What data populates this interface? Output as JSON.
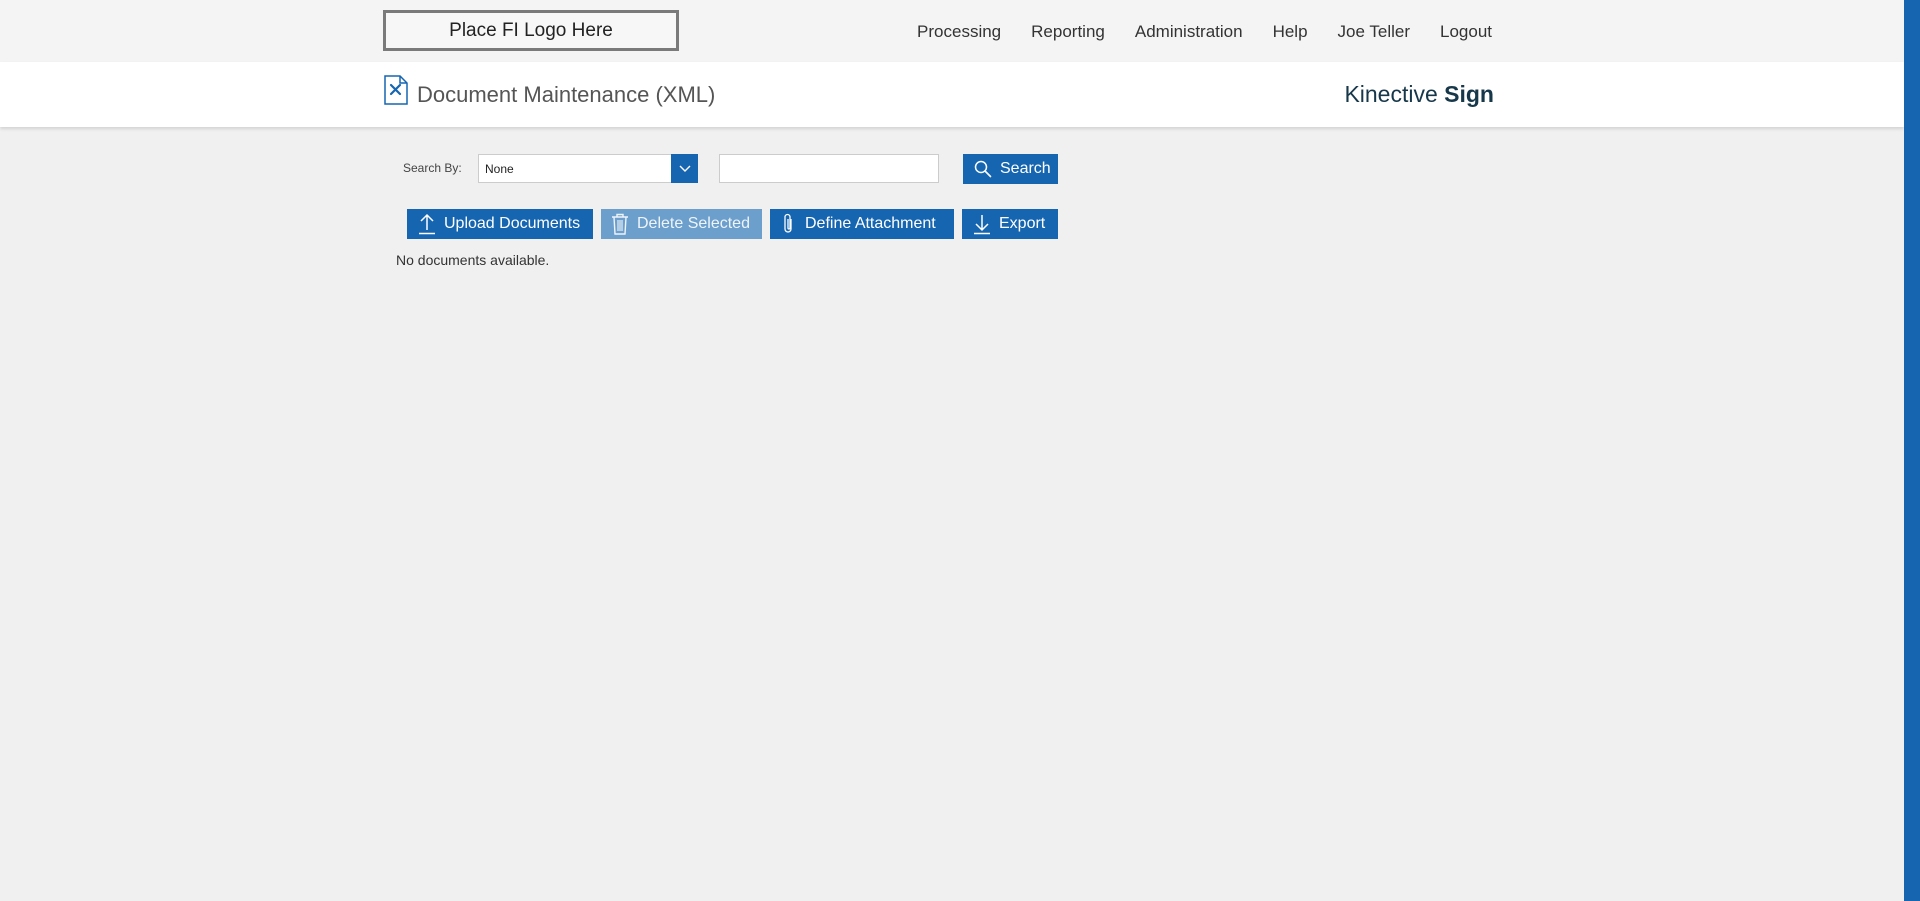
{
  "header": {
    "logo_text": "Place FI Logo Here",
    "nav": [
      "Processing",
      "Reporting",
      "Administration",
      "Help",
      "Joe Teller",
      "Logout"
    ]
  },
  "titlebar": {
    "page_title": "Document Maintenance (XML)",
    "page_icon": "document-x-icon",
    "brand_light": "Kinective",
    "brand_bold": "Sign"
  },
  "search": {
    "label": "Search By:",
    "selected": "None",
    "input_value": "",
    "input_placeholder": "",
    "button_label": "Search",
    "button_icon": "search-icon"
  },
  "actions": {
    "upload_label": "Upload Documents",
    "upload_icon": "upload-icon",
    "delete_label": "Delete Selected",
    "delete_icon": "trash-icon",
    "delete_disabled": true,
    "attach_label": "Define Attachment",
    "attach_icon": "paperclip-icon",
    "export_label": "Export",
    "export_icon": "download-icon"
  },
  "list": {
    "empty_message": "No documents available."
  },
  "colors": {
    "primary": "#1565b0",
    "disabled": "#6c9fcc",
    "brand_text": "#17384a",
    "background": "#f0f0f0"
  }
}
